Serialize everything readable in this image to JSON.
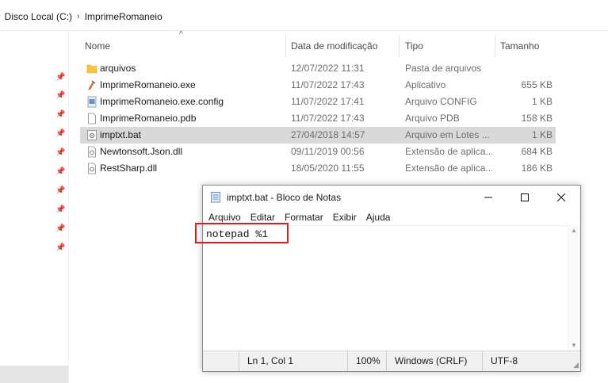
{
  "breadcrumb": {
    "items": [
      "Disco Local (C:)",
      "ImprimeRomaneio"
    ]
  },
  "columns": {
    "name": "Nome",
    "date": "Data de modificação",
    "type": "Tipo",
    "size": "Tamanho"
  },
  "files": [
    {
      "name": "arquivos",
      "date": "12/07/2022 11:31",
      "type": "Pasta de arquivos",
      "size": "",
      "icon": "folder-icon"
    },
    {
      "name": "ImprimeRomaneio.exe",
      "date": "11/07/2022 17:43",
      "type": "Aplicativo",
      "size": "655 KB",
      "icon": "application-icon"
    },
    {
      "name": "ImprimeRomaneio.exe.config",
      "date": "11/07/2022 17:41",
      "type": "Arquivo CONFIG",
      "size": "1 KB",
      "icon": "config-file-icon"
    },
    {
      "name": "ImprimeRomaneio.pdb",
      "date": "11/07/2022 17:43",
      "type": "Arquivo PDB",
      "size": "158 KB",
      "icon": "file-icon"
    },
    {
      "name": "imptxt.bat",
      "date": "27/04/2018 14:57",
      "type": "Arquivo em Lotes ...",
      "size": "1 KB",
      "icon": "batch-file-icon"
    },
    {
      "name": "Newtonsoft.Json.dll",
      "date": "09/11/2019 00:56",
      "type": "Extensão de aplica...",
      "size": "684 KB",
      "icon": "dll-file-icon"
    },
    {
      "name": "RestSharp.dll",
      "date": "18/05/2020 11:55",
      "type": "Extensão de aplica...",
      "size": "186 KB",
      "icon": "dll-file-icon"
    }
  ],
  "notepad": {
    "title": "imptxt.bat - Bloco de Notas",
    "menu": [
      "Arquivo",
      "Editar",
      "Formatar",
      "Exibir",
      "Ajuda"
    ],
    "content": "notepad %1",
    "status": {
      "position": "Ln 1, Col 1",
      "zoom": "100%",
      "line_ending": "Windows (CRLF)",
      "encoding": "UTF-8"
    }
  },
  "colors": {
    "selection": "#d9d9d9",
    "highlight": "#e01b1b",
    "folder": "#f5c542"
  }
}
